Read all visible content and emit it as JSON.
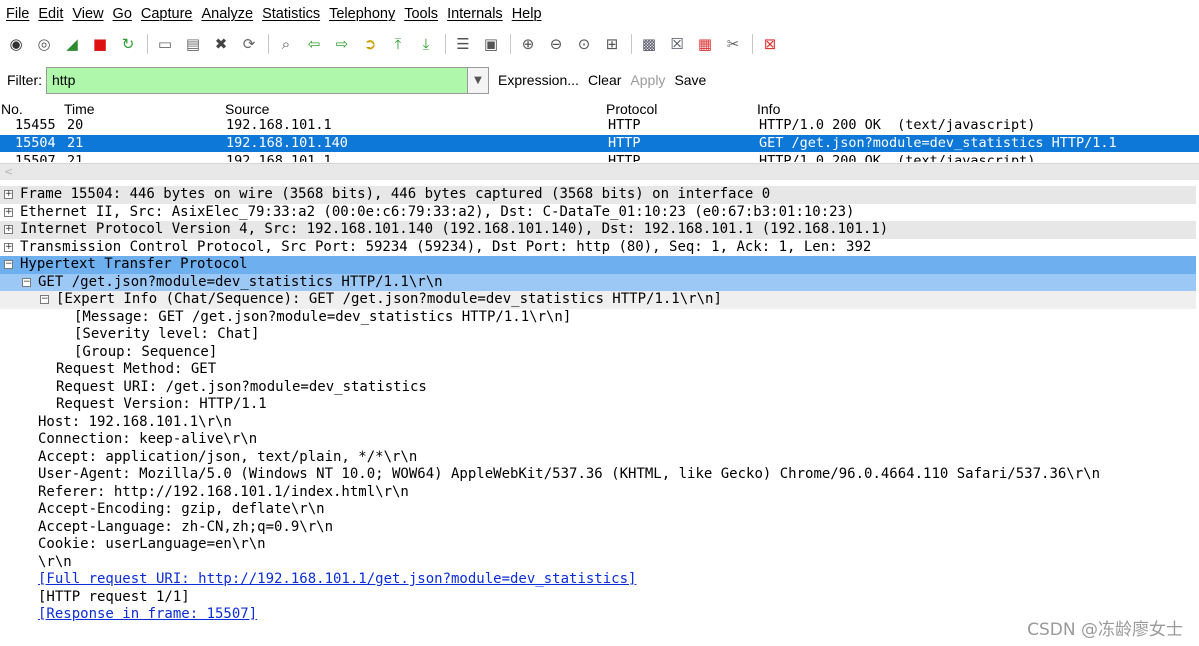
{
  "menu": [
    "File",
    "Edit",
    "View",
    "Go",
    "Capture",
    "Analyze",
    "Statistics",
    "Telephony",
    "Tools",
    "Internals",
    "Help"
  ],
  "toolbar_icons": [
    "interface-list-icon",
    "capture-options-icon",
    "start-capture-icon",
    "stop-capture-icon",
    "restart-capture-icon",
    "open-file-icon",
    "save-file-icon",
    "close-file-icon",
    "reload-icon",
    "find-packet-icon",
    "go-back-icon",
    "go-forward-icon",
    "go-to-packet-icon",
    "go-first-icon",
    "go-last-icon",
    "colorize-icon",
    "auto-scroll-icon",
    "zoom-in-icon",
    "zoom-out-icon",
    "zoom-normal-icon",
    "resize-columns-icon",
    "capture-filters-icon",
    "display-filters-icon",
    "coloring-rules-icon",
    "preferences-icon",
    "help-icon"
  ],
  "filter": {
    "label": "Filter:",
    "value": "http",
    "expression": "Expression...",
    "clear": "Clear",
    "apply": "Apply",
    "save": "Save"
  },
  "packet_list": {
    "columns": {
      "no": "No.",
      "time": "Time",
      "source": "Source",
      "protocol": "Protocol",
      "info": "Info"
    },
    "rows": [
      {
        "no": "15455",
        "time": "20",
        "source": "192.168.101.1",
        "protocol": "HTTP",
        "info": "HTTP/1.0 200 OK  (text/javascript)"
      },
      {
        "no": "15504",
        "time": "21",
        "source": "192.168.101.140",
        "protocol": "HTTP",
        "info": "GET /get.json?module=dev_statistics HTTP/1.1"
      },
      {
        "no": "15507",
        "time": "21",
        "source": "192.168.101.1",
        "protocol": "HTTP",
        "info": "HTTP/1.0 200 OK  (text/javascript)"
      }
    ]
  },
  "details": [
    {
      "toggle": "+",
      "text": "Frame 15504: 446 bytes on wire (3568 bits), 446 bytes captured (3568 bits) on interface 0"
    },
    {
      "toggle": "+",
      "text": "Ethernet II, Src: AsixElec_79:33:a2 (00:0e:c6:79:33:a2), Dst: C-DataTe_01:10:23 (e0:67:b3:01:10:23)"
    },
    {
      "toggle": "+",
      "text": "Internet Protocol Version 4, Src: 192.168.101.140 (192.168.101.140), Dst: 192.168.101.1 (192.168.101.1)"
    },
    {
      "toggle": "+",
      "text": "Transmission Control Protocol, Src Port: 59234 (59234), Dst Port: http (80), Seq: 1, Ack: 1, Len: 392"
    },
    {
      "toggle": "−",
      "text": "Hypertext Transfer Protocol"
    },
    {
      "toggle": "−",
      "text": "GET /get.json?module=dev_statistics HTTP/1.1\\r\\n"
    },
    {
      "toggle": "−",
      "text": "[Expert Info (Chat/Sequence): GET /get.json?module=dev_statistics HTTP/1.1\\r\\n]"
    },
    {
      "toggle": "",
      "text": "[Message: GET /get.json?module=dev_statistics HTTP/1.1\\r\\n]"
    },
    {
      "toggle": "",
      "text": "[Severity level: Chat]"
    },
    {
      "toggle": "",
      "text": "[Group: Sequence]"
    },
    {
      "toggle": "",
      "text": "Request Method: GET"
    },
    {
      "toggle": "",
      "text": "Request URI: /get.json?module=dev_statistics"
    },
    {
      "toggle": "",
      "text": "Request Version: HTTP/1.1"
    },
    {
      "toggle": "",
      "text": "Host: 192.168.101.1\\r\\n"
    },
    {
      "toggle": "",
      "text": "Connection: keep-alive\\r\\n"
    },
    {
      "toggle": "",
      "text": "Accept: application/json, text/plain, */*\\r\\n"
    },
    {
      "toggle": "",
      "text": "User-Agent: Mozilla/5.0 (Windows NT 10.0; WOW64) AppleWebKit/537.36 (KHTML, like Gecko) Chrome/96.0.4664.110 Safari/537.36\\r\\n"
    },
    {
      "toggle": "",
      "text": "Referer: http://192.168.101.1/index.html\\r\\n"
    },
    {
      "toggle": "",
      "text": "Accept-Encoding: gzip, deflate\\r\\n"
    },
    {
      "toggle": "",
      "text": "Accept-Language: zh-CN,zh;q=0.9\\r\\n"
    },
    {
      "toggle": "",
      "text": "Cookie: userLanguage=en\\r\\n"
    },
    {
      "toggle": "",
      "text": "\\r\\n"
    },
    {
      "toggle": "",
      "text": "[Full request URI: http://192.168.101.1/get.json?module=dev_statistics]"
    },
    {
      "toggle": "",
      "text": "[HTTP request 1/1]"
    },
    {
      "toggle": "",
      "text": "[Response in frame: 15507]"
    }
  ],
  "watermark": "CSDN @冻龄廖女士",
  "colors": {
    "selected_row": "#0d78d7",
    "filter_ok": "#aff7aa",
    "http_layer": "#6eaff0",
    "link": "#0b2dd7"
  }
}
